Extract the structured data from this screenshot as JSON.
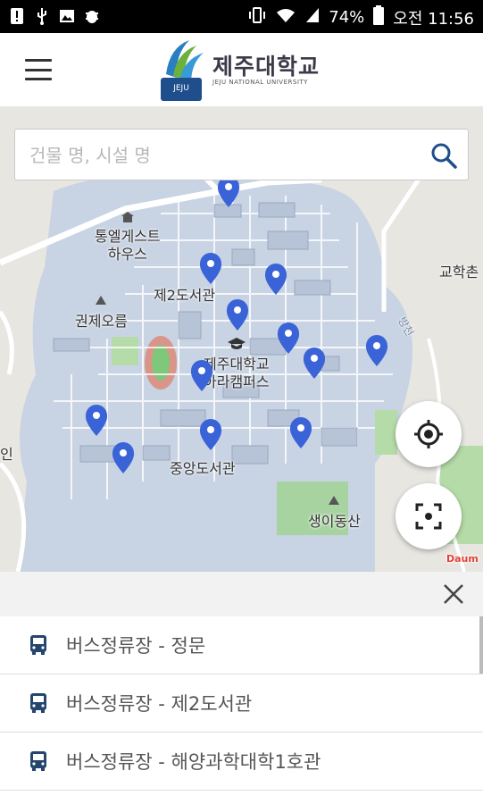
{
  "status_bar": {
    "left_icons": [
      "alert-icon",
      "usb-icon",
      "image-icon",
      "bug-icon"
    ],
    "right_icons": [
      "vibrate-icon",
      "wifi-icon",
      "signal-icon",
      "battery-icon"
    ],
    "battery": "74%",
    "time": "오전 11:56"
  },
  "header": {
    "logo_title": "제주대학교",
    "logo_subtitle": "JEJU NATIONAL UNIVERSITY",
    "logo_emblem_text": "JEJU"
  },
  "search": {
    "placeholder": "건물 명, 시설 명"
  },
  "map": {
    "labels": {
      "guesthouse": "통엘게스트\n하우스",
      "library2": "제2도서관",
      "gwonje": "권제오름",
      "campus": "제주대학교\n아라캠퍼스",
      "central_library": "중앙도서관",
      "saengi": "생이동산",
      "gyohak": "교학촌",
      "stream": "방천",
      "left_edge": "인",
      "daum": "Daum"
    }
  },
  "bottom_panel": {
    "items": [
      {
        "label": "버스정류장 - 정문"
      },
      {
        "label": "버스정류장 - 제2도서관"
      },
      {
        "label": "버스정류장 - 해양과학대학1호관"
      }
    ]
  },
  "colors": {
    "campus_fill": "#c8d3e3",
    "pin": "#3a63d8",
    "bus_icon": "#24456e",
    "status_bar": "#000000"
  }
}
